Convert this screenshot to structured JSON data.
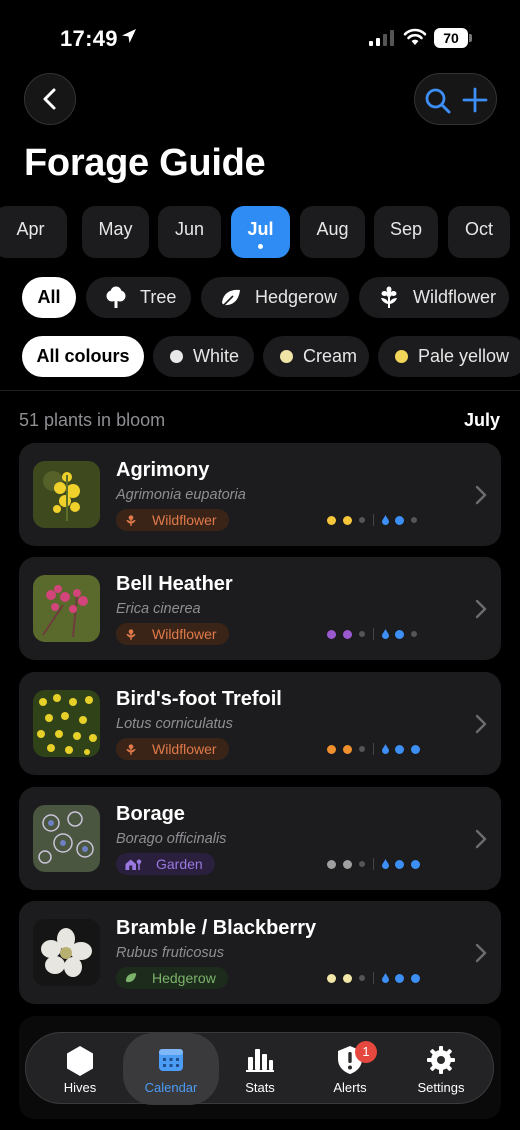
{
  "status_bar": {
    "time": "17:49",
    "battery": "70"
  },
  "header": {
    "title": "Forage Guide"
  },
  "months": [
    "Apr",
    "May",
    "Jun",
    "Jul",
    "Aug",
    "Sep",
    "Oct"
  ],
  "selected_month": "Jul",
  "categories": [
    {
      "label": "All",
      "icon": "",
      "active": true
    },
    {
      "label": "Tree",
      "icon": "tree-icon"
    },
    {
      "label": "Hedgerow",
      "icon": "leaf-icon"
    },
    {
      "label": "Wildflower",
      "icon": "flower-icon"
    }
  ],
  "colours": [
    {
      "label": "All colours",
      "active": true
    },
    {
      "label": "White",
      "color": "#e8e8e8"
    },
    {
      "label": "Cream",
      "color": "#efe3a6"
    },
    {
      "label": "Pale yellow",
      "color": "#f2d65a"
    }
  ],
  "summary": {
    "count_text": "51 plants in bloom",
    "month": "July"
  },
  "plants": [
    {
      "name": "Agrimony",
      "latin": "Agrimonia eupatoria",
      "category": "Wildflower",
      "pollen_color": "#f5c53a",
      "pollen_level": 2,
      "nectar_level": 2
    },
    {
      "name": "Bell Heather",
      "latin": "Erica cinerea",
      "category": "Wildflower",
      "pollen_color": "#9b59d0",
      "pollen_level": 2,
      "nectar_level": 2
    },
    {
      "name": "Bird's-foot Trefoil",
      "latin": "Lotus corniculatus",
      "category": "Wildflower",
      "pollen_color": "#ef8f2e",
      "pollen_level": 2,
      "nectar_level": 3
    },
    {
      "name": "Borage",
      "latin": "Borago officinalis",
      "category": "Garden",
      "pollen_color": "#a0a0a0",
      "pollen_level": 2,
      "nectar_level": 3
    },
    {
      "name": "Bramble / Blackberry",
      "latin": "Rubus fruticosus",
      "category": "Hedgerow",
      "pollen_color": "#f2e6a8",
      "pollen_level": 2,
      "nectar_level": 3
    }
  ],
  "colors": {
    "accent": "#2f8cf5",
    "card": "#1c1c1e",
    "nectar": "#3d8ef5"
  },
  "tabs": [
    {
      "label": "Hives",
      "icon": "hexagon-icon"
    },
    {
      "label": "Calendar",
      "icon": "calendar-icon",
      "active": true
    },
    {
      "label": "Stats",
      "icon": "bar-chart-icon"
    },
    {
      "label": "Alerts",
      "icon": "alert-shield-icon",
      "badge": "1"
    },
    {
      "label": "Settings",
      "icon": "gear-icon"
    }
  ]
}
